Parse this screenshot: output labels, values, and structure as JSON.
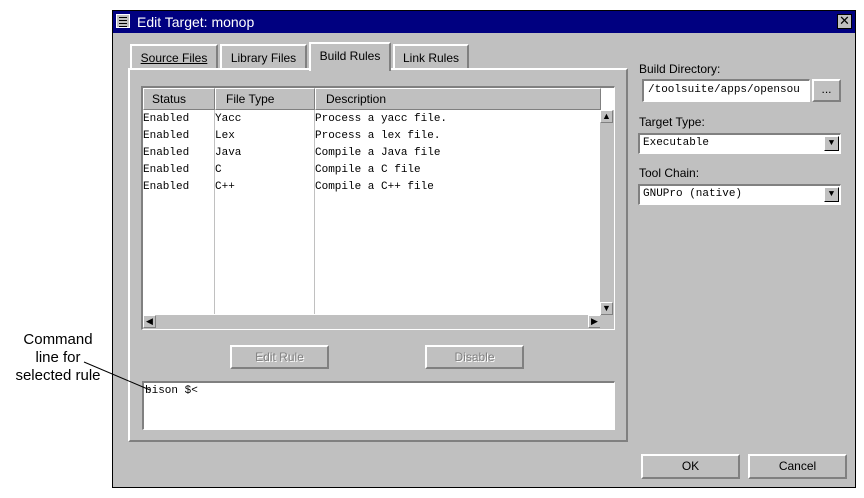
{
  "window": {
    "title": "Edit Target: monop",
    "close_glyph": "✕"
  },
  "tabs": [
    {
      "label": "Source Files",
      "mnemonic_index": 0
    },
    {
      "label": "Library Files",
      "mnemonic_index": 0
    },
    {
      "label": "Build Rules",
      "mnemonic_index": 0,
      "active": true
    },
    {
      "label": "Link Rules",
      "mnemonic_index": 5
    }
  ],
  "rules_list": {
    "columns": [
      "Status",
      "File Type",
      "Description"
    ],
    "rows": [
      {
        "status": "Enabled",
        "file_type": "Yacc",
        "description": "Process a yacc file."
      },
      {
        "status": "Enabled",
        "file_type": "Lex",
        "description": "Process a lex file."
      },
      {
        "status": "Enabled",
        "file_type": "Java",
        "description": "Compile a Java file"
      },
      {
        "status": "Enabled",
        "file_type": "C",
        "description": "Compile a C file"
      },
      {
        "status": "Enabled",
        "file_type": "C++",
        "description": "Compile a C++ file"
      }
    ]
  },
  "buttons": {
    "edit_rule": "Edit Rule",
    "disable": "Disable",
    "browse": "...",
    "ok": "OK",
    "cancel": "Cancel"
  },
  "command_line": {
    "value": "bison $<"
  },
  "build_directory": {
    "label": "Build Directory:",
    "value": "/toolsuite/apps/opensou"
  },
  "target_type": {
    "label": "Target Type:",
    "value": "Executable"
  },
  "tool_chain": {
    "label": "Tool Chain:",
    "value": "GNUPro (native)"
  },
  "annotation": {
    "lines": [
      "Command",
      "line for",
      "selected rule"
    ]
  }
}
